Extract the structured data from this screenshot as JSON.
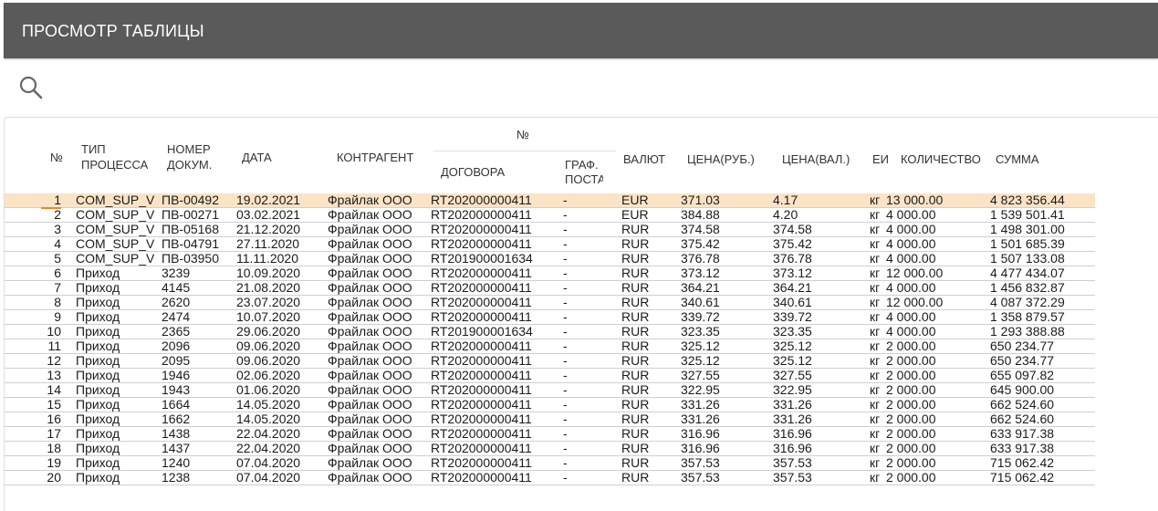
{
  "header": {
    "title": "ПРОСМОТР ТАБЛИЦЫ"
  },
  "search": {
    "icon": "search-icon"
  },
  "table": {
    "columns": {
      "num": "№",
      "type_line1": "ТИП",
      "type_line2": "ПРОЦЕССА",
      "doc_line1": "НОМЕР",
      "doc_line2": "ДОКУМ.",
      "date": "ДАТА",
      "party": "КОНТРАГЕНТ",
      "contract_group": "№",
      "contract": "ДОГОВОРА",
      "sched_line1": "ГРАФ.",
      "sched_line2": "ПОСТАВ",
      "currency": "ВАЛЮТА",
      "price_rub": "ЦЕНА(РУБ.)",
      "price_val": "ЦЕНА(ВАЛ.)",
      "unit": "ЕИ",
      "qty": "КОЛИЧЕСТВО",
      "sum": "СУММА"
    },
    "rows": [
      {
        "n": "1",
        "type": "COM_SUP_V",
        "doc": "ПВ-00492",
        "date": "19.02.2021",
        "party": "Фрайлак ООО",
        "contract": "RT202000000411",
        "sched": "-",
        "cur": "EUR",
        "rub": "371.03",
        "val": "4.17",
        "unit": "кг",
        "qty": "13 000.00",
        "sum": "4 823 356.44",
        "selected": true
      },
      {
        "n": "2",
        "type": "COM_SUP_V",
        "doc": "ПВ-00271",
        "date": "03.02.2021",
        "party": "Фрайлак ООО",
        "contract": "RT202000000411",
        "sched": "-",
        "cur": "EUR",
        "rub": "384.88",
        "val": "4.20",
        "unit": "кг",
        "qty": "4 000.00",
        "sum": "1 539 501.41"
      },
      {
        "n": "3",
        "type": "COM_SUP_V",
        "doc": "ПВ-05168",
        "date": "21.12.2020",
        "party": "Фрайлак ООО",
        "contract": "RT202000000411",
        "sched": "-",
        "cur": "RUR",
        "rub": "374.58",
        "val": "374.58",
        "unit": "кг",
        "qty": "4 000.00",
        "sum": "1 498 301.00"
      },
      {
        "n": "4",
        "type": "COM_SUP_V",
        "doc": "ПВ-04791",
        "date": "27.11.2020",
        "party": "Фрайлак ООО",
        "contract": "RT202000000411",
        "sched": "-",
        "cur": "RUR",
        "rub": "375.42",
        "val": "375.42",
        "unit": "кг",
        "qty": "4 000.00",
        "sum": "1 501 685.39"
      },
      {
        "n": "5",
        "type": "COM_SUP_V",
        "doc": "ПВ-03950",
        "date": "11.11.2020",
        "party": "Фрайлак ООО",
        "contract": "RT201900001634",
        "sched": "-",
        "cur": "RUR",
        "rub": "376.78",
        "val": "376.78",
        "unit": "кг",
        "qty": "4 000.00",
        "sum": "1 507 133.08"
      },
      {
        "n": "6",
        "type": "Приход",
        "doc": "3239",
        "date": "10.09.2020",
        "party": "Фрайлак ООО",
        "contract": "RT202000000411",
        "sched": "-",
        "cur": "RUR",
        "rub": "373.12",
        "val": "373.12",
        "unit": "кг",
        "qty": "12 000.00",
        "sum": "4 477 434.07"
      },
      {
        "n": "7",
        "type": "Приход",
        "doc": "4145",
        "date": "21.08.2020",
        "party": "Фрайлак ООО",
        "contract": "RT202000000411",
        "sched": "-",
        "cur": "RUR",
        "rub": "364.21",
        "val": "364.21",
        "unit": "кг",
        "qty": "4 000.00",
        "sum": "1 456 832.87"
      },
      {
        "n": "8",
        "type": "Приход",
        "doc": "2620",
        "date": "23.07.2020",
        "party": "Фрайлак ООО",
        "contract": "RT202000000411",
        "sched": "-",
        "cur": "RUR",
        "rub": "340.61",
        "val": "340.61",
        "unit": "кг",
        "qty": "12 000.00",
        "sum": "4 087 372.29"
      },
      {
        "n": "9",
        "type": "Приход",
        "doc": "2474",
        "date": "10.07.2020",
        "party": "Фрайлак ООО",
        "contract": "RT202000000411",
        "sched": "-",
        "cur": "RUR",
        "rub": "339.72",
        "val": "339.72",
        "unit": "кг",
        "qty": "4 000.00",
        "sum": "1 358 879.57"
      },
      {
        "n": "10",
        "type": "Приход",
        "doc": "2365",
        "date": "29.06.2020",
        "party": "Фрайлак ООО",
        "contract": "RT201900001634",
        "sched": "-",
        "cur": "RUR",
        "rub": "323.35",
        "val": "323.35",
        "unit": "кг",
        "qty": "4 000.00",
        "sum": "1 293 388.88"
      },
      {
        "n": "11",
        "type": "Приход",
        "doc": "2096",
        "date": "09.06.2020",
        "party": "Фрайлак ООО",
        "contract": "RT202000000411",
        "sched": "-",
        "cur": "RUR",
        "rub": "325.12",
        "val": "325.12",
        "unit": "кг",
        "qty": "2 000.00",
        "sum": "650 234.77"
      },
      {
        "n": "12",
        "type": "Приход",
        "doc": "2095",
        "date": "09.06.2020",
        "party": "Фрайлак ООО",
        "contract": "RT202000000411",
        "sched": "-",
        "cur": "RUR",
        "rub": "325.12",
        "val": "325.12",
        "unit": "кг",
        "qty": "2 000.00",
        "sum": "650 234.77"
      },
      {
        "n": "13",
        "type": "Приход",
        "doc": "1946",
        "date": "02.06.2020",
        "party": "Фрайлак ООО",
        "contract": "RT202000000411",
        "sched": "-",
        "cur": "RUR",
        "rub": "327.55",
        "val": "327.55",
        "unit": "кг",
        "qty": "2 000.00",
        "sum": "655 097.82"
      },
      {
        "n": "14",
        "type": "Приход",
        "doc": "1943",
        "date": "01.06.2020",
        "party": "Фрайлак ООО",
        "contract": "RT202000000411",
        "sched": "-",
        "cur": "RUR",
        "rub": "322.95",
        "val": "322.95",
        "unit": "кг",
        "qty": "2 000.00",
        "sum": "645 900.00"
      },
      {
        "n": "15",
        "type": "Приход",
        "doc": "1664",
        "date": "14.05.2020",
        "party": "Фрайлак ООО",
        "contract": "RT202000000411",
        "sched": "-",
        "cur": "RUR",
        "rub": "331.26",
        "val": "331.26",
        "unit": "кг",
        "qty": "2 000.00",
        "sum": "662 524.60"
      },
      {
        "n": "16",
        "type": "Приход",
        "doc": "1662",
        "date": "14.05.2020",
        "party": "Фрайлак ООО",
        "contract": "RT202000000411",
        "sched": "-",
        "cur": "RUR",
        "rub": "331.26",
        "val": "331.26",
        "unit": "кг",
        "qty": "2 000.00",
        "sum": "662 524.60"
      },
      {
        "n": "17",
        "type": "Приход",
        "doc": "1438",
        "date": "22.04.2020",
        "party": "Фрайлак ООО",
        "contract": "RT202000000411",
        "sched": "-",
        "cur": "RUR",
        "rub": "316.96",
        "val": "316.96",
        "unit": "кг",
        "qty": "2 000.00",
        "sum": "633 917.38"
      },
      {
        "n": "18",
        "type": "Приход",
        "doc": "1437",
        "date": "22.04.2020",
        "party": "Фрайлак ООО",
        "contract": "RT202000000411",
        "sched": "-",
        "cur": "RUR",
        "rub": "316.96",
        "val": "316.96",
        "unit": "кг",
        "qty": "2 000.00",
        "sum": "633 917.38"
      },
      {
        "n": "19",
        "type": "Приход",
        "doc": "1240",
        "date": "07.04.2020",
        "party": "Фрайлак ООО",
        "contract": "RT202000000411",
        "sched": "-",
        "cur": "RUR",
        "rub": "357.53",
        "val": "357.53",
        "unit": "кг",
        "qty": "2 000.00",
        "sum": "715 062.42"
      },
      {
        "n": "20",
        "type": "Приход",
        "doc": "1238",
        "date": "07.04.2020",
        "party": "Фрайлак ООО",
        "contract": "RT202000000411",
        "sched": "-",
        "cur": "RUR",
        "rub": "357.53",
        "val": "357.53",
        "unit": "кг",
        "qty": "2 000.00",
        "sum": "715 062.42"
      }
    ]
  },
  "colors": {
    "header_bg": "#5a5a5a",
    "selected_row": "#fbe3c6",
    "selected_accent": "#e08a2c"
  }
}
